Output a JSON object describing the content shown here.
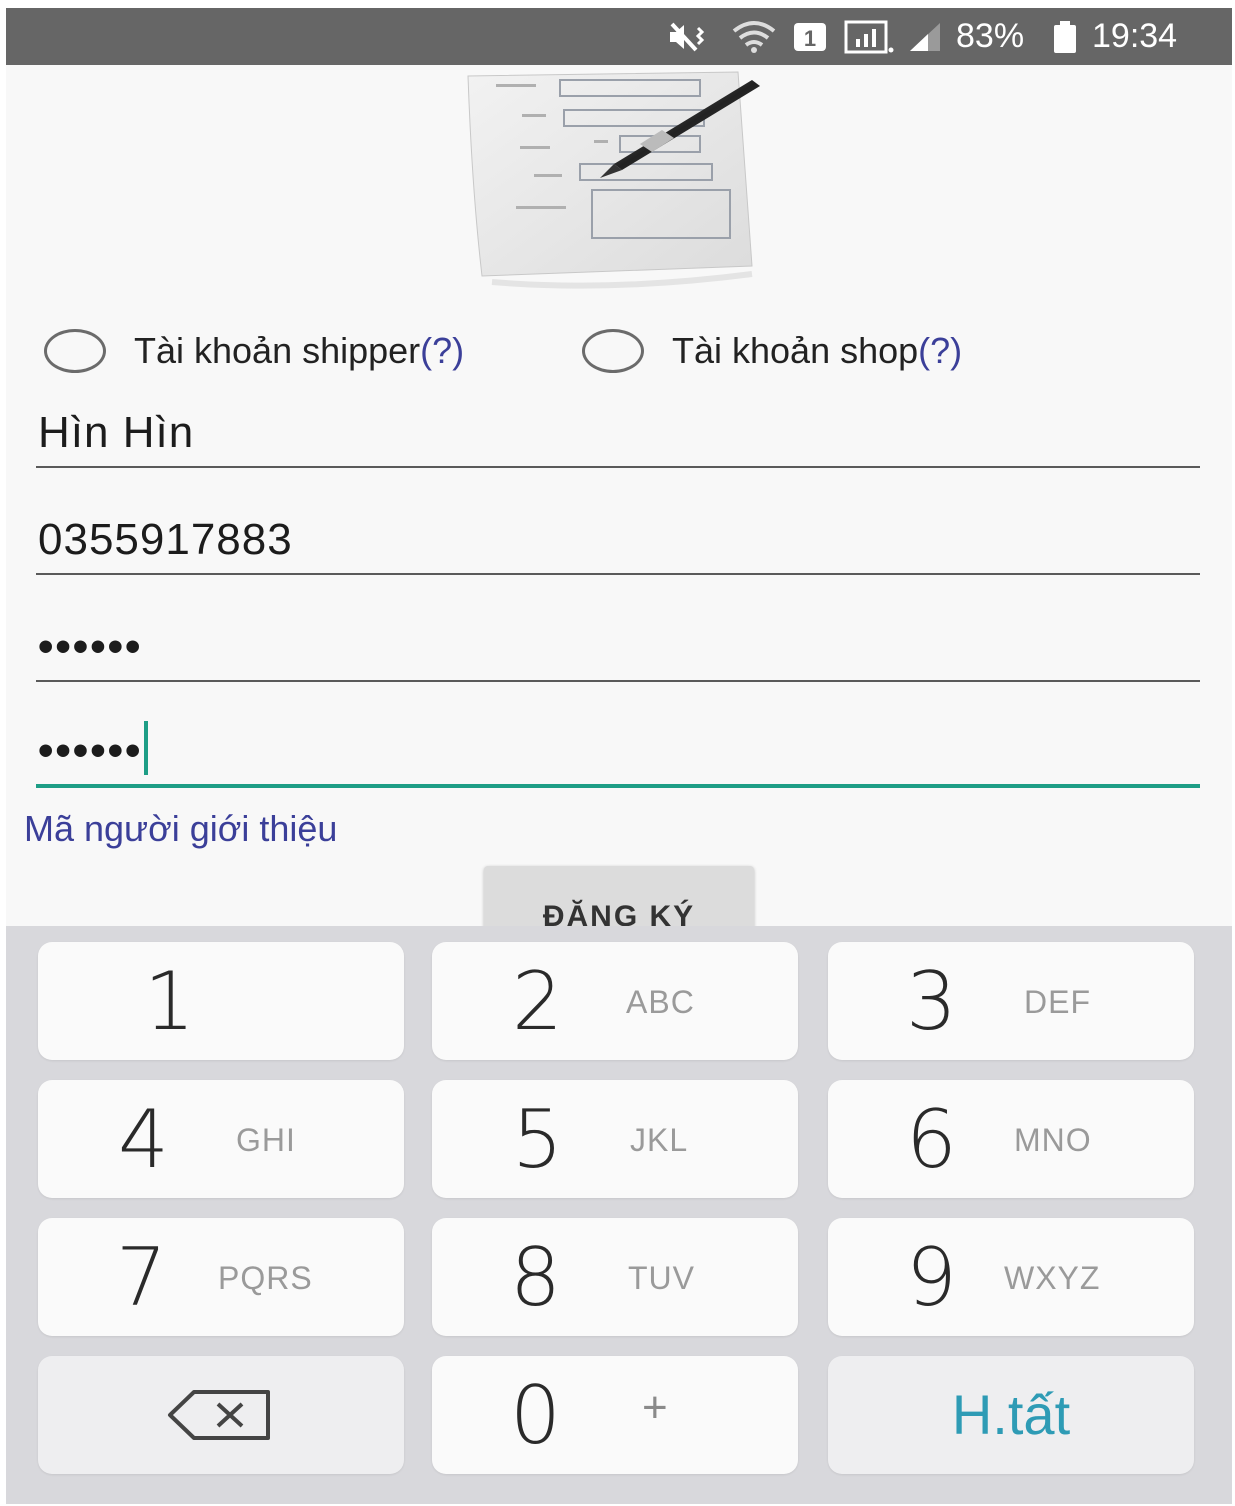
{
  "status_bar": {
    "battery_percent": "83%",
    "time": "19:34"
  },
  "account_type": {
    "options": [
      {
        "label": "Tài khoản shipper",
        "help": "(?)",
        "selected": false
      },
      {
        "label": "Tài khoản shop",
        "help": "(?)",
        "selected": false
      }
    ]
  },
  "form": {
    "name_value": "Hìn Hìn",
    "phone_value": "0355917883",
    "password_mask": "••••••",
    "confirm_password_mask": "••••••",
    "referral_link": "Mã người giới thiệu",
    "register_label": "ĐĂNG KÝ"
  },
  "keypad": {
    "keys": [
      {
        "digit": "1",
        "letters": ""
      },
      {
        "digit": "2",
        "letters": "ABC"
      },
      {
        "digit": "3",
        "letters": "DEF"
      },
      {
        "digit": "4",
        "letters": "GHI"
      },
      {
        "digit": "5",
        "letters": "JKL"
      },
      {
        "digit": "6",
        "letters": "MNO"
      },
      {
        "digit": "7",
        "letters": "PQRS"
      },
      {
        "digit": "8",
        "letters": "TUV"
      },
      {
        "digit": "9",
        "letters": "WXYZ"
      },
      {
        "digit": "0",
        "letters": "+"
      }
    ],
    "backspace_icon": "backspace-icon",
    "done_label": "H.tất"
  },
  "colors": {
    "accent": "#1e9e86",
    "link": "#3b3f99",
    "done": "#2e9bb5",
    "status_bar": "#666666"
  }
}
